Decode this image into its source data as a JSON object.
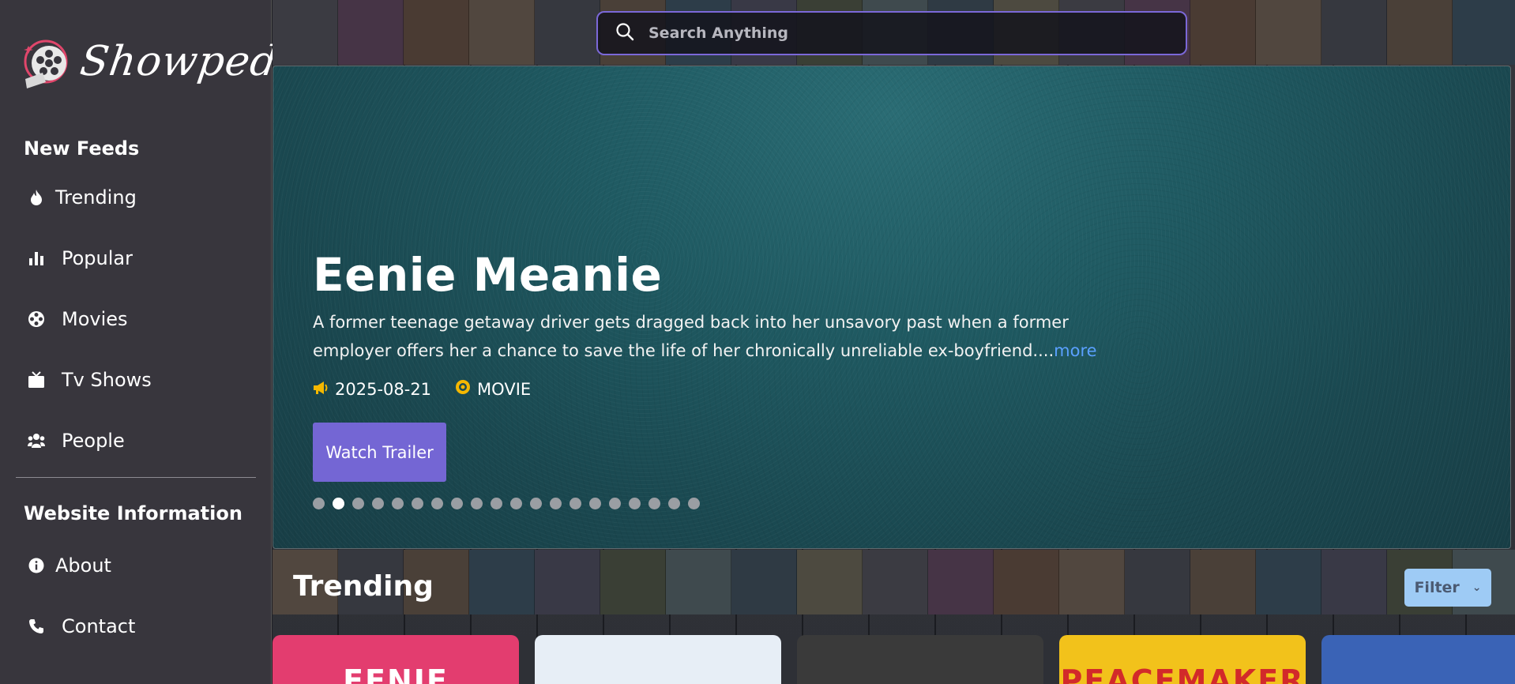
{
  "brand": {
    "name": "Showpedia"
  },
  "sidebar": {
    "sections": [
      {
        "title": "New Feeds"
      },
      {
        "title": "Website Information"
      }
    ],
    "feed_items": [
      {
        "label": "Trending",
        "icon": "fire-icon"
      },
      {
        "label": "Popular",
        "icon": "bar-chart-icon"
      },
      {
        "label": "Movies",
        "icon": "film-reel-icon"
      },
      {
        "label": "Tv Shows",
        "icon": "tv-icon"
      },
      {
        "label": "People",
        "icon": "people-icon"
      }
    ],
    "info_items": [
      {
        "label": "About",
        "icon": "info-icon"
      },
      {
        "label": "Contact",
        "icon": "phone-icon"
      }
    ]
  },
  "search": {
    "placeholder": "Search Anything"
  },
  "hero": {
    "title": "Eenie Meanie",
    "description": "A former teenage getaway driver gets dragged back into her unsavory past when a former employer offers her a chance to save the life of her chronically unreliable ex-boyfriend....",
    "more_label": "more",
    "release_date": "2025-08-21",
    "media_type": "MOVIE",
    "watch_trailer_label": "Watch Trailer",
    "slide_count": 20,
    "active_slide": 2
  },
  "trending": {
    "title": "Trending",
    "filter_label": "Filter",
    "cards": [
      {
        "name": "eenie-meanie-poster",
        "text": "EENIE",
        "color": "#e33d6f"
      },
      {
        "name": "superman-poster",
        "text": "",
        "color": "#e7eef6"
      },
      {
        "name": "bw-portrait-poster",
        "text": "",
        "color": "#3a3a3a"
      },
      {
        "name": "peacemaker-poster",
        "text": "PEACEMAKER",
        "color": "#f2c21b"
      },
      {
        "name": "alien-creature-poster",
        "text": "",
        "color": "#3a63b6"
      }
    ]
  },
  "colors": {
    "accent": "#7466d4",
    "link": "#5aa0ff",
    "meta_icon": "#f5b800",
    "sidebar_bg": "#38363d",
    "filter_bg": "#9ecbf5"
  }
}
